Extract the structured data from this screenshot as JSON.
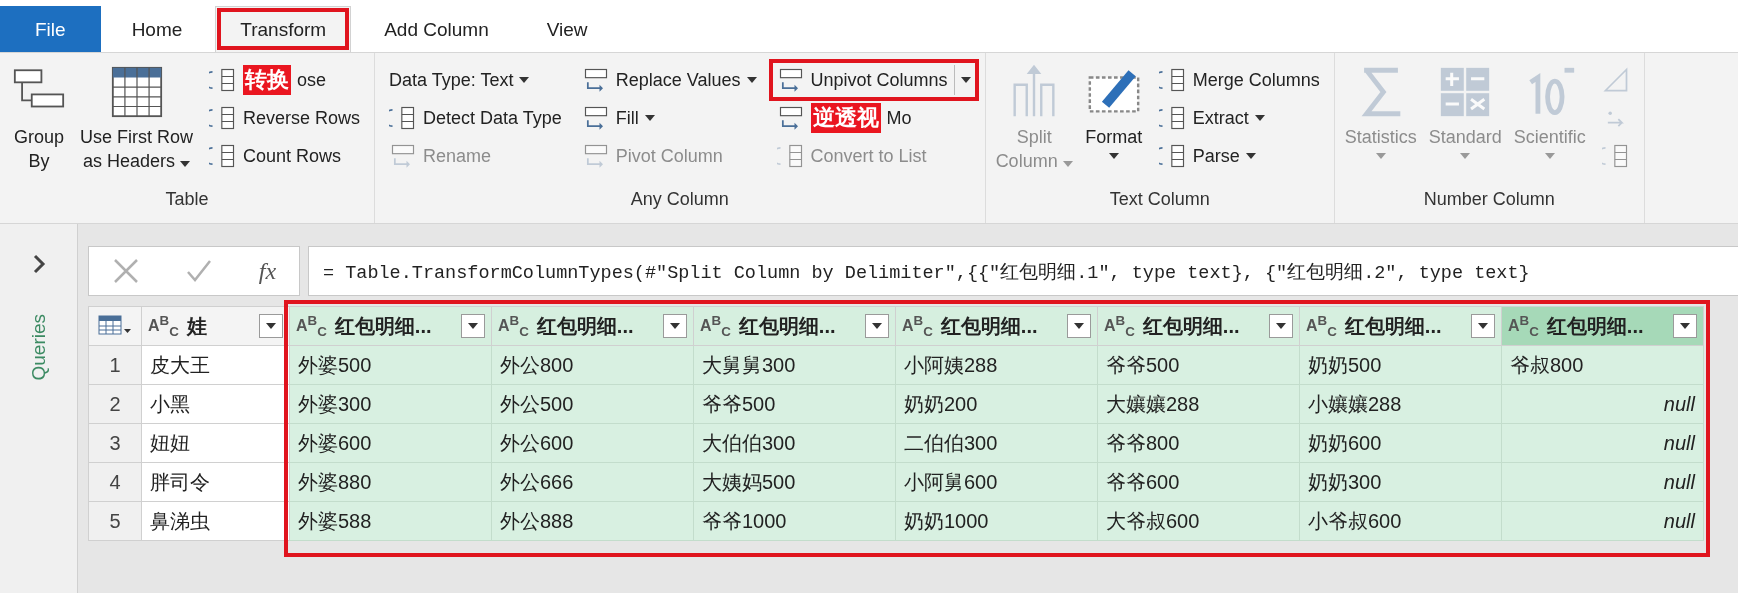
{
  "tabs": [
    {
      "label": "File",
      "kind": "file",
      "selected": false,
      "highlighted": false
    },
    {
      "label": "Home",
      "kind": "tab",
      "selected": false,
      "highlighted": false
    },
    {
      "label": "Transform",
      "kind": "tab",
      "selected": true,
      "highlighted": true
    },
    {
      "label": "Add Column",
      "kind": "tab",
      "selected": false,
      "highlighted": false
    },
    {
      "label": "View",
      "kind": "tab",
      "selected": false,
      "highlighted": false
    }
  ],
  "ribbon": {
    "groups": [
      {
        "title": "Table",
        "columns": [
          {
            "kind": "large",
            "label": "Group\nBy",
            "disabled": false,
            "dropdown": false
          },
          {
            "kind": "large",
            "label": "Use First Row\nas Headers",
            "dropdown": true,
            "caret_below": false,
            "disabled": false
          },
          {
            "kind": "stack",
            "items": [
              {
                "label": "ose",
                "annotation": "转换",
                "disabled": false,
                "dropdown": false
              },
              {
                "label": "Reverse Rows",
                "disabled": false,
                "dropdown": false
              },
              {
                "label": "Count Rows",
                "disabled": false,
                "dropdown": false
              }
            ]
          }
        ]
      },
      {
        "title": "Any Column",
        "columns": [
          {
            "kind": "stack",
            "items": [
              {
                "label": "Data Type: Text",
                "disabled": false,
                "dropdown": true
              },
              {
                "label": "Detect Data Type",
                "disabled": false,
                "dropdown": false
              },
              {
                "label": "Rename",
                "disabled": true,
                "dropdown": false
              }
            ]
          },
          {
            "kind": "stack",
            "items": [
              {
                "label": "Replace Values",
                "disabled": false,
                "dropdown": true
              },
              {
                "label": "Fill",
                "disabled": false,
                "dropdown": true
              },
              {
                "label": "Pivot Column",
                "disabled": true,
                "dropdown": false
              }
            ]
          },
          {
            "kind": "stack",
            "items": [
              {
                "label": "Unpivot Columns",
                "disabled": false,
                "dropdown": false,
                "split": true,
                "highlighted": true
              },
              {
                "label": "Mo",
                "annotation": "逆透视",
                "disabled": false,
                "dropdown": false
              },
              {
                "label": "Convert to List",
                "disabled": true,
                "dropdown": false
              }
            ]
          }
        ]
      },
      {
        "title": "Text Column",
        "columns": [
          {
            "kind": "large",
            "label": "Split\nColumn",
            "dropdown": true,
            "caret_below": false,
            "disabled": true
          },
          {
            "kind": "large",
            "label": "Format",
            "dropdown": true,
            "caret_below": true,
            "disabled": false
          },
          {
            "kind": "stack",
            "items": [
              {
                "label": "Merge Columns",
                "disabled": false,
                "dropdown": false
              },
              {
                "label": "Extract",
                "disabled": false,
                "dropdown": true
              },
              {
                "label": "Parse",
                "disabled": false,
                "dropdown": true
              }
            ]
          }
        ]
      },
      {
        "title": "Number Column",
        "columns": [
          {
            "kind": "large",
            "label": "Statistics",
            "dropdown": true,
            "caret_below": true,
            "disabled": true
          },
          {
            "kind": "large",
            "label": "Standard",
            "dropdown": true,
            "caret_below": true,
            "disabled": true
          },
          {
            "kind": "large",
            "label": "Scientific",
            "dropdown": true,
            "caret_below": true,
            "disabled": true
          },
          {
            "kind": "icon_stack",
            "items": [
              {
                "disabled": true
              },
              {
                "disabled": true
              },
              {
                "disabled": true
              }
            ]
          }
        ]
      }
    ]
  },
  "queries_pane": {
    "label": "Queries",
    "expanded": false
  },
  "formula_bar": {
    "function_label": "fx",
    "formula": "= Table.TransformColumnTypes(#\"Split Column by Delimiter\",{{\"红包明细.1\", type text}, {\"红包明细.2\", type text}"
  },
  "table": {
    "columns": [
      {
        "name": "娃",
        "type": "A$^{B}$$_{C}$",
        "selected": false,
        "highlighted": false
      },
      {
        "name": "红包明细...",
        "type": "A$^{B}$$_{C}$",
        "selected": false,
        "highlighted": true
      },
      {
        "name": "红包明细...",
        "type": "A$^{B}$$_{C}$",
        "selected": false,
        "highlighted": true
      },
      {
        "name": "红包明细...",
        "type": "A$^{B}$$_{C}$",
        "selected": false,
        "highlighted": true
      },
      {
        "name": "红包明细...",
        "type": "A$^{B}$$_{C}$",
        "selected": false,
        "highlighted": true
      },
      {
        "name": "红包明细...",
        "type": "A$^{B}$$_{C}$",
        "selected": false,
        "highlighted": true
      },
      {
        "name": "红包明细...",
        "type": "A$^{B}$$_{C}$",
        "selected": false,
        "highlighted": true
      },
      {
        "name": "红包明细...",
        "type": "A$^{B}$$_{C}$",
        "selected": true,
        "highlighted": true
      }
    ],
    "rows": [
      {
        "index": "1",
        "cells": [
          "皮大王",
          "外婆500",
          "外公800",
          "大舅舅300",
          "小阿姨288",
          "爷爷500",
          "奶奶500",
          "爷叔800"
        ]
      },
      {
        "index": "2",
        "cells": [
          "小黑",
          "外婆300",
          "外公500",
          "爷爷500",
          "奶奶200",
          "大孃孃288",
          "小孃孃288",
          {
            "text": "null",
            "kind": "null"
          }
        ]
      },
      {
        "index": "3",
        "cells": [
          "妞妞",
          "外婆600",
          "外公600",
          "大伯伯300",
          "二伯伯300",
          "爷爷800",
          "奶奶600",
          {
            "text": "null",
            "kind": "null"
          }
        ]
      },
      {
        "index": "4",
        "cells": [
          "胖司令",
          "外婆880",
          "外公666",
          "大姨妈500",
          "小阿舅600",
          "爷爷600",
          "奶奶300",
          {
            "text": "null",
            "kind": "null"
          }
        ]
      },
      {
        "index": "5",
        "cells": [
          "鼻涕虫",
          "外婆588",
          "外公888",
          "爷爷1000",
          "奶奶1000",
          "大爷叔600",
          "小爷叔600",
          {
            "text": "null",
            "kind": "null"
          }
        ]
      }
    ]
  }
}
